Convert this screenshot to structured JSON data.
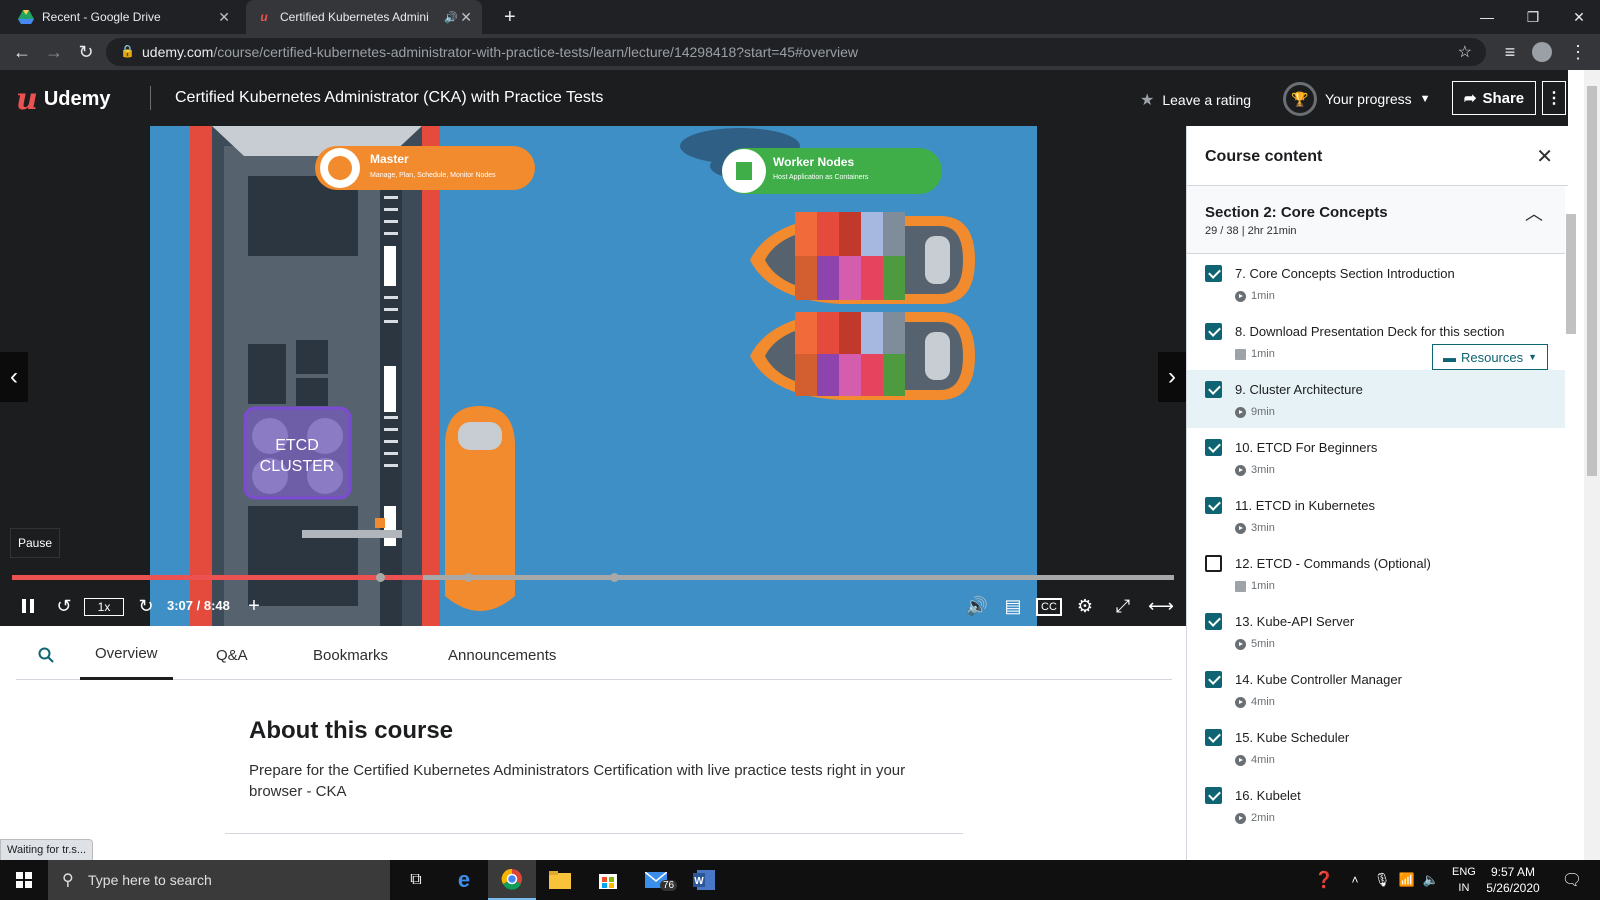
{
  "browser": {
    "tabs": [
      {
        "title": "Recent - Google Drive",
        "active": false
      },
      {
        "title": "Certified Kubernetes Admini",
        "active": true
      }
    ],
    "new_tab": "+",
    "url_host": "udemy.com",
    "url_path": "/course/certified-kubernetes-administrator-with-practice-tests/learn/lecture/14298418?start=45#overview"
  },
  "header": {
    "logo": "Udemy",
    "course_title": "Certified Kubernetes Administrator (CKA) with Practice Tests",
    "rating_label": "Leave a rating",
    "progress_label": "Your progress",
    "share_label": "Share"
  },
  "video": {
    "scene_labels": {
      "master_title": "Master",
      "master_sub": "Manage, Plan, Schedule, Monitor Nodes",
      "worker_title": "Worker Nodes",
      "worker_sub": "Host Application as Containers",
      "etcd": "ETCD",
      "cluster": "CLUSTER"
    },
    "tooltip": "Pause",
    "playback_rate": "1x",
    "timecode": "3:07 / 8:48",
    "progress_fraction": 0.354
  },
  "lecture_tabs": [
    "Overview",
    "Q&A",
    "Bookmarks",
    "Announcements"
  ],
  "about": {
    "heading": "About this course",
    "description": "Prepare for the Certified Kubernetes Administrators Certification with live practice tests right in your browser - CKA"
  },
  "status_bubble": "Waiting for tr.s...",
  "sidebar": {
    "title": "Course content",
    "section": {
      "title": "Section 2: Core Concepts",
      "meta": "29 / 38 | 2hr 21min"
    },
    "resources_label": "Resources",
    "items": [
      {
        "title": "7. Core Concepts Section Introduction",
        "duration": "1min",
        "kind": "video",
        "done": true
      },
      {
        "title": "8. Download Presentation Deck for this section",
        "duration": "1min",
        "kind": "doc",
        "done": true
      },
      {
        "title": "9. Cluster Architecture",
        "duration": "9min",
        "kind": "video",
        "done": true
      },
      {
        "title": "10. ETCD For Beginners",
        "duration": "3min",
        "kind": "video",
        "done": true
      },
      {
        "title": "11. ETCD in Kubernetes",
        "duration": "3min",
        "kind": "video",
        "done": true
      },
      {
        "title": "12. ETCD - Commands (Optional)",
        "duration": "1min",
        "kind": "doc",
        "done": false
      },
      {
        "title": "13. Kube-API Server",
        "duration": "5min",
        "kind": "video",
        "done": true
      },
      {
        "title": "14. Kube Controller Manager",
        "duration": "4min",
        "kind": "video",
        "done": true
      },
      {
        "title": "15. Kube Scheduler",
        "duration": "4min",
        "kind": "video",
        "done": true
      },
      {
        "title": "16. Kubelet",
        "duration": "2min",
        "kind": "video",
        "done": true
      }
    ]
  },
  "taskbar": {
    "search_placeholder": "Type here to search",
    "mail_badge": "76",
    "lang_top": "ENG",
    "lang_bottom": "IN",
    "time": "9:57 AM",
    "date": "5/26/2020"
  },
  "colors": {
    "udemy_red": "#ec5252",
    "accent_teal": "#0f6473",
    "header_bg": "#1c1d1f"
  }
}
